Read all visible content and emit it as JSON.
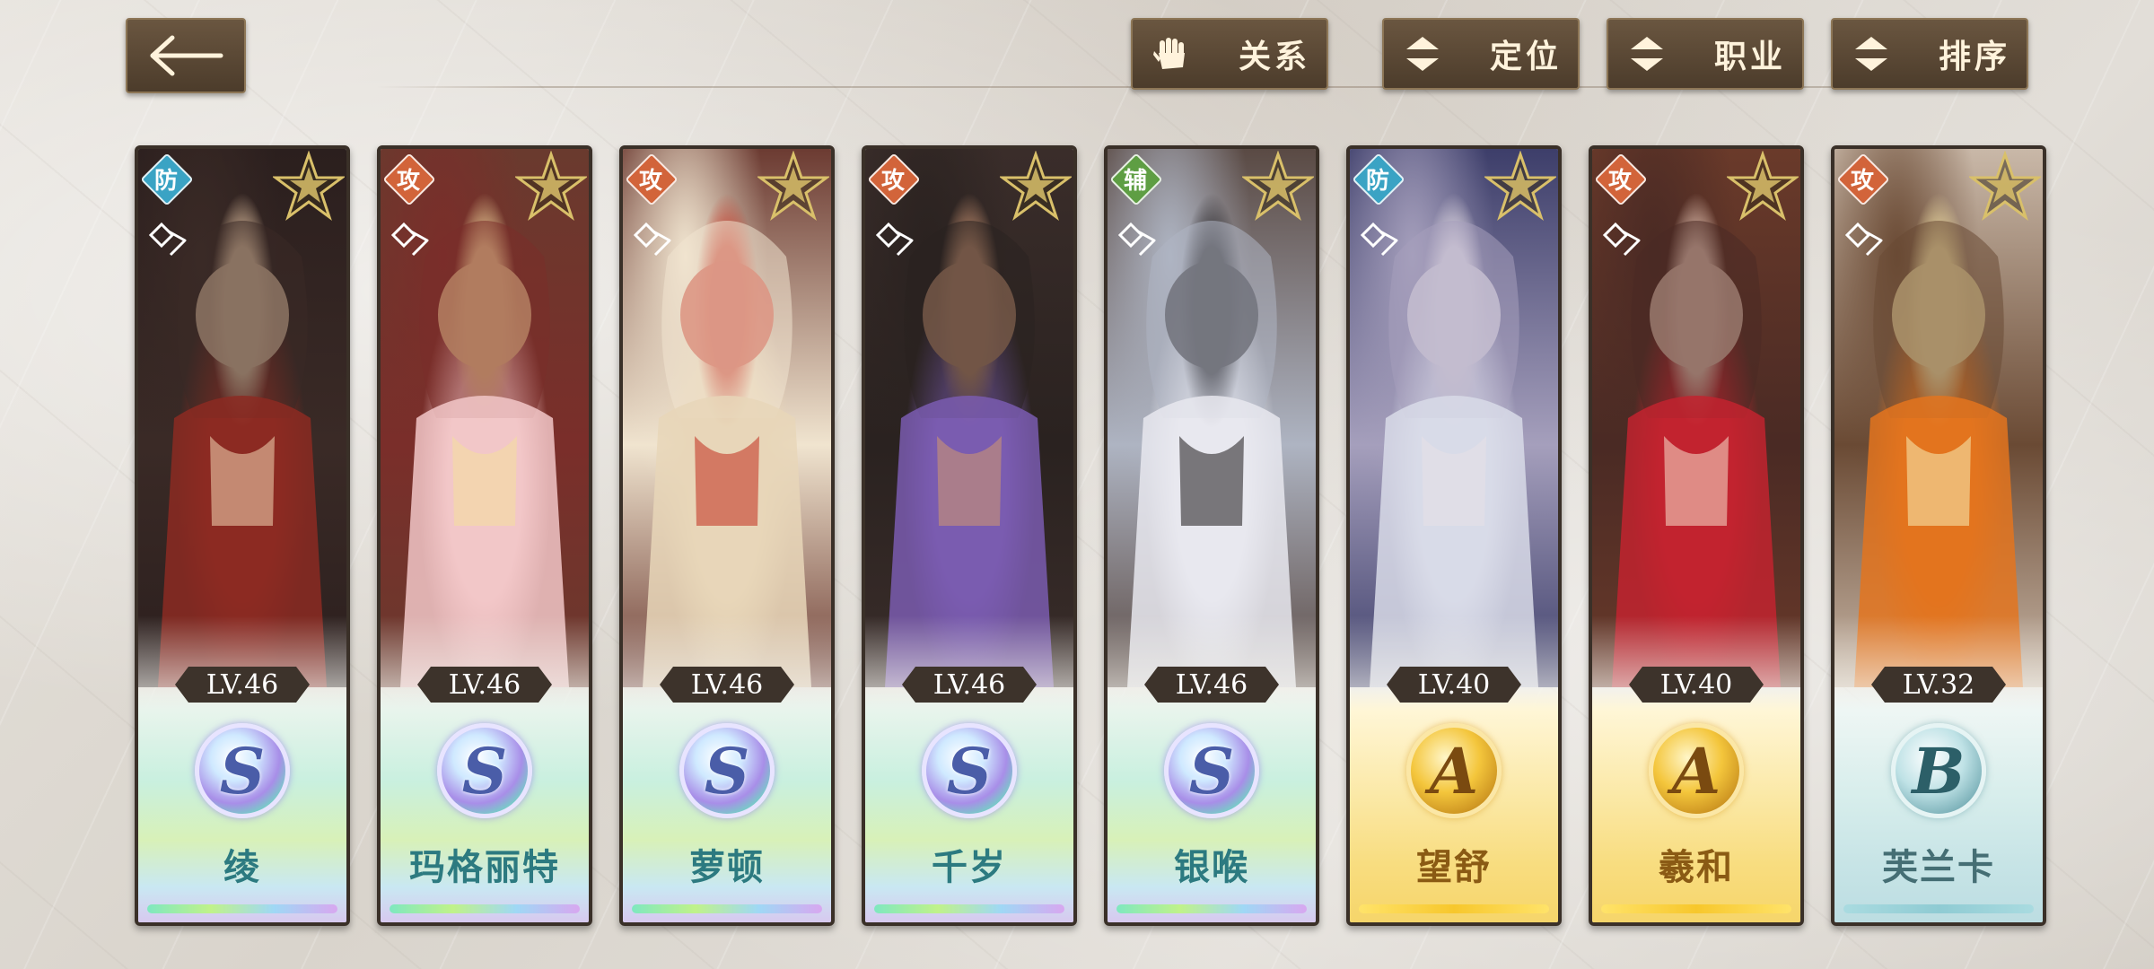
{
  "toolbar": {
    "relation_label": "关系",
    "position_label": "定位",
    "class_label": "职业",
    "sort_label": "排序"
  },
  "colors": {
    "defense": "#3aa3c4",
    "attack": "#d2643a",
    "support": "#5e9e43",
    "star_gold": "#d9c06a"
  },
  "icons": {
    "back": "arrow-left-icon",
    "relation": "gauntlet-icon",
    "sort_arrows": "up-down-arrows-icon",
    "card_check": "double-check-icon",
    "card_star": "star-icon"
  },
  "characters": [
    {
      "name": "绫",
      "role": "防",
      "role_type": "defense",
      "level": "LV.46",
      "rank": "S",
      "palette": [
        "#2b1f1e",
        "#8c2a22",
        "#e9c9a8",
        "#3a2a26"
      ]
    },
    {
      "name": "玛格丽特",
      "role": "攻",
      "role_type": "attack",
      "level": "LV.46",
      "rank": "S",
      "palette": [
        "#6a3a2e",
        "#f2c7c8",
        "#f4dca0",
        "#7a2e2a"
      ]
    },
    {
      "name": "萝顿",
      "role": "攻",
      "role_type": "attack",
      "level": "LV.46",
      "rank": "S",
      "palette": [
        "#6c3b32",
        "#e8d6b8",
        "#c43a2a",
        "#f0e4cf"
      ]
    },
    {
      "name": "千岁",
      "role": "攻",
      "role_type": "attack",
      "level": "LV.46",
      "rank": "S",
      "palette": [
        "#3a2d2a",
        "#7a5cb0",
        "#c99373",
        "#2a2220"
      ]
    },
    {
      "name": "银喉",
      "role": "辅",
      "role_type": "support",
      "level": "LV.46",
      "rank": "S",
      "palette": [
        "#5a4a44",
        "#e8e8ee",
        "#2d2a2c",
        "#aeb4c2"
      ]
    },
    {
      "name": "望舒",
      "role": "防",
      "role_type": "defense",
      "level": "LV.40",
      "rank": "A",
      "palette": [
        "#3d3e6a",
        "#d8dbe8",
        "#e6dfe6",
        "#a59fbc"
      ]
    },
    {
      "name": "羲和",
      "role": "攻",
      "role_type": "attack",
      "level": "LV.40",
      "rank": "A",
      "palette": [
        "#6a3a2a",
        "#c2232f",
        "#f1d0bf",
        "#4a2a24"
      ]
    },
    {
      "name": "芙兰卡",
      "role": "攻",
      "role_type": "attack",
      "level": "LV.32",
      "rank": "B",
      "palette": [
        "#c9b8a8",
        "#e3741f",
        "#f5e4a8",
        "#6a4a34"
      ]
    }
  ]
}
